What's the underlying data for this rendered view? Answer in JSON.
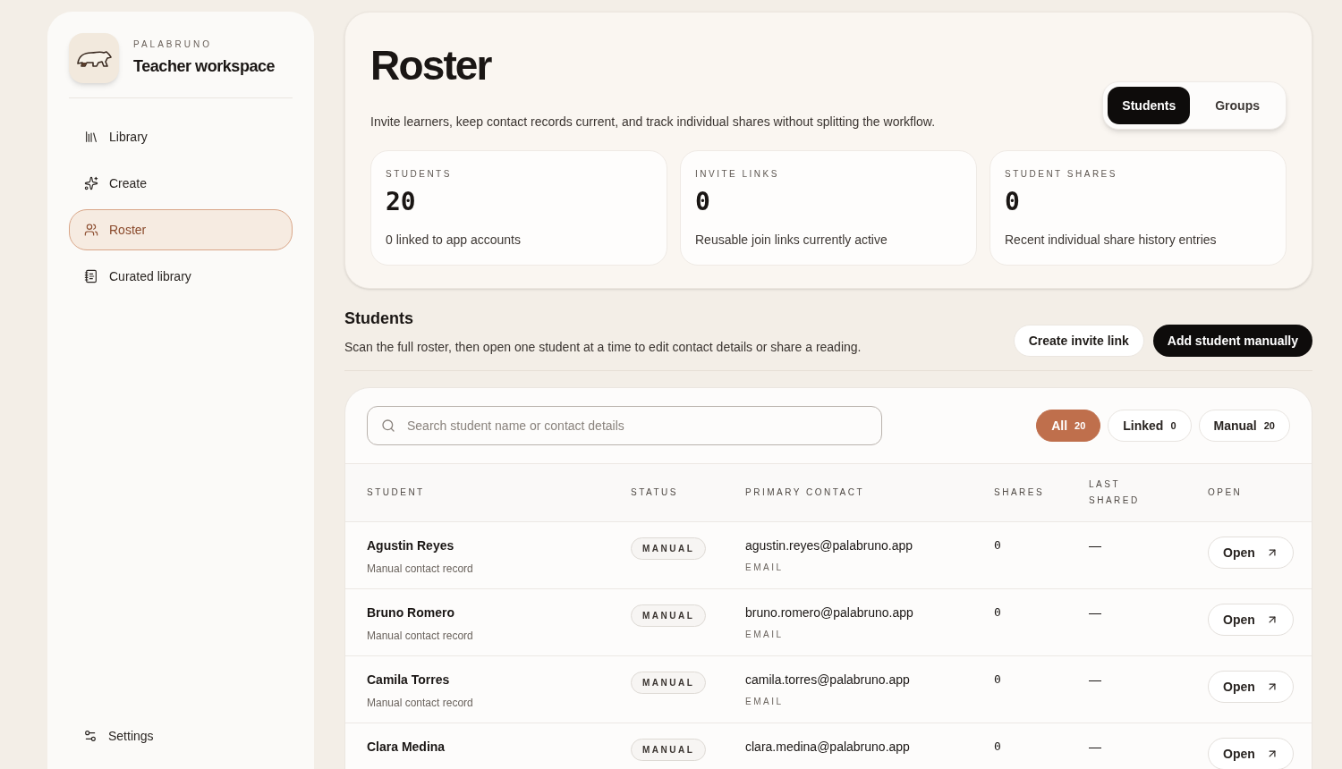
{
  "sidebar": {
    "brand": "PALABRUNO",
    "title": "Teacher workspace",
    "items": [
      {
        "label": "Library",
        "selected": false
      },
      {
        "label": "Create",
        "selected": false
      },
      {
        "label": "Roster",
        "selected": true
      },
      {
        "label": "Curated library",
        "selected": false
      }
    ],
    "footer": {
      "label": "Settings"
    }
  },
  "header": {
    "title": "Roster",
    "subtitle": "Invite learners, keep contact records current, and track individual shares without splitting the workflow.",
    "tabs": [
      {
        "label": "Students",
        "selected": true
      },
      {
        "label": "Groups",
        "selected": false
      }
    ],
    "stats": [
      {
        "label": "STUDENTS",
        "value": "20",
        "note": "0 linked to app accounts"
      },
      {
        "label": "INVITE LINKS",
        "value": "0",
        "note": "Reusable join links currently active"
      },
      {
        "label": "STUDENT SHARES",
        "value": "0",
        "note": "Recent individual share history entries"
      }
    ]
  },
  "section": {
    "title": "Students",
    "description": "Scan the full roster, then open one student at a time to edit contact details or share a reading.",
    "buttons": [
      {
        "label": "Create invite link",
        "kind": "secondary"
      },
      {
        "label": "Add student manually",
        "kind": "primary"
      }
    ]
  },
  "search": {
    "placeholder": "Search student name or contact details"
  },
  "filters": [
    {
      "label": "All",
      "count": "20",
      "selected": true
    },
    {
      "label": "Linked",
      "count": "0",
      "selected": false
    },
    {
      "label": "Manual",
      "count": "20",
      "selected": false
    }
  ],
  "table": {
    "columns": [
      "STUDENT",
      "STATUS",
      "PRIMARY CONTACT",
      "SHARES",
      "LAST\nSHARED",
      "OPEN"
    ],
    "rows": [
      {
        "name": "Agustin Reyes",
        "note": "Manual contact record",
        "status": "MANUAL",
        "contact": "agustin.reyes@palabruno.app",
        "contact_type": "EMAIL",
        "shares": "0",
        "last_shared": "—",
        "action": "Open"
      },
      {
        "name": "Bruno Romero",
        "note": "Manual contact record",
        "status": "MANUAL",
        "contact": "bruno.romero@palabruno.app",
        "contact_type": "EMAIL",
        "shares": "0",
        "last_shared": "—",
        "action": "Open"
      },
      {
        "name": "Camila Torres",
        "note": "Manual contact record",
        "status": "MANUAL",
        "contact": "camila.torres@palabruno.app",
        "contact_type": "EMAIL",
        "shares": "0",
        "last_shared": "—",
        "action": "Open"
      },
      {
        "name": "Clara Medina",
        "status": "MANUAL",
        "contact": "clara.medina@palabruno.app",
        "shares": "0",
        "last_shared": "—",
        "action": "Open"
      }
    ]
  }
}
